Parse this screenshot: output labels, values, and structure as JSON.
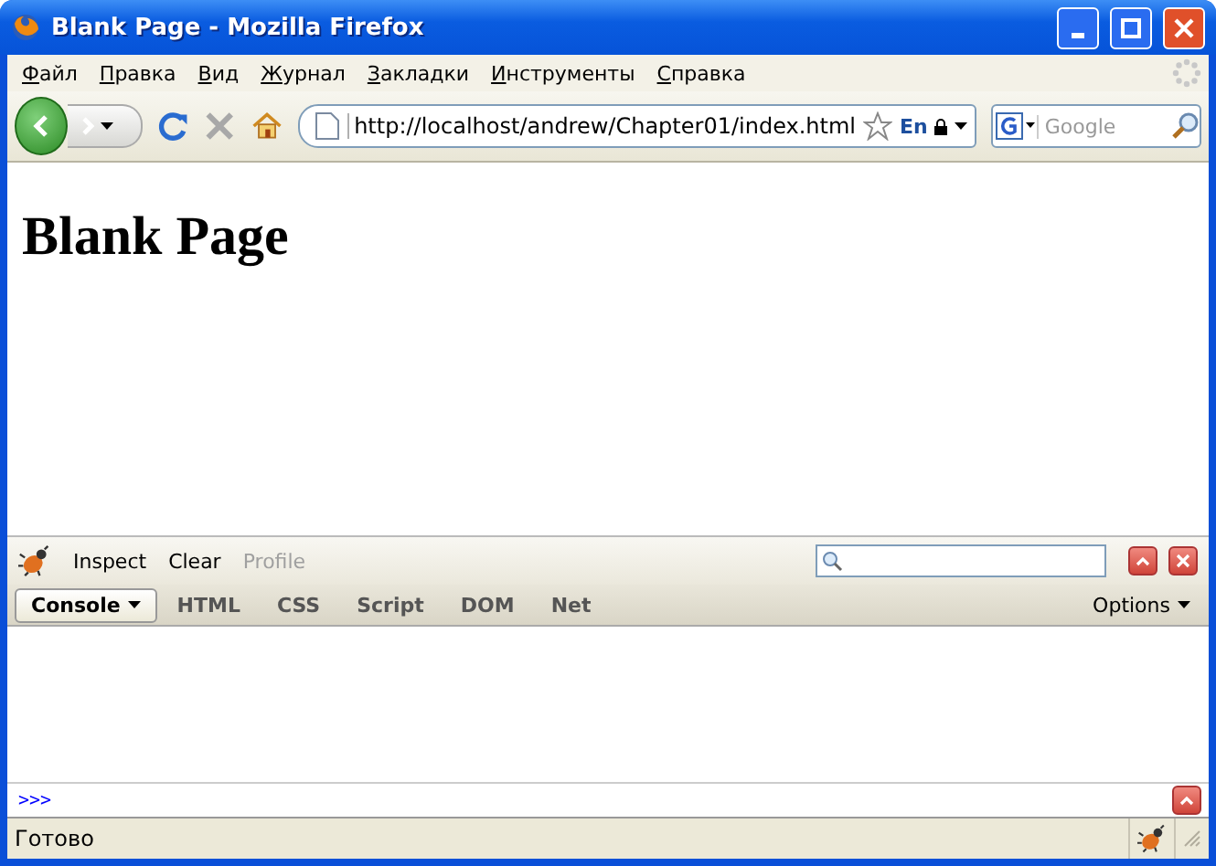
{
  "window": {
    "title": "Blank Page - Mozilla Firefox"
  },
  "menu": [
    "Файл",
    "Правка",
    "Вид",
    "Журнал",
    "Закладки",
    "Инструменты",
    "Справка"
  ],
  "address": {
    "value": "http://localhost/andrew/Chapter01/index.html",
    "language": "En"
  },
  "search": {
    "placeholder": "Google"
  },
  "page": {
    "heading": "Blank Page"
  },
  "firebug": {
    "tools": [
      {
        "label": "Inspect",
        "disabled": false
      },
      {
        "label": "Clear",
        "disabled": false
      },
      {
        "label": "Profile",
        "disabled": true
      }
    ],
    "tabs": [
      {
        "label": "Console",
        "selected": true
      },
      {
        "label": "HTML",
        "selected": false
      },
      {
        "label": "CSS",
        "selected": false
      },
      {
        "label": "Script",
        "selected": false
      },
      {
        "label": "DOM",
        "selected": false
      },
      {
        "label": "Net",
        "selected": false
      }
    ],
    "options": "Options",
    "prompt": ">>>"
  },
  "status_bar": {
    "text": "Готово"
  }
}
